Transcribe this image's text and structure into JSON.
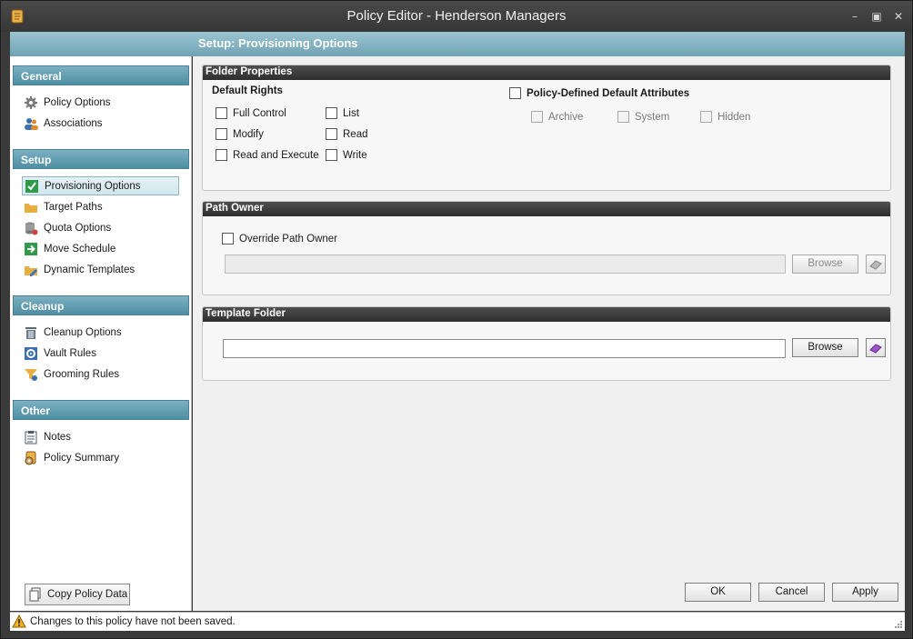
{
  "window": {
    "title": "Policy Editor - Henderson Managers",
    "controls": [
      "minimize-icon",
      "maximize-icon",
      "close-icon"
    ]
  },
  "header": {
    "title": "Setup: Provisioning Options"
  },
  "sidebar": {
    "sections": [
      {
        "title": "General",
        "items": [
          {
            "label": "Policy Options",
            "icon": "gear-icon"
          },
          {
            "label": "Associations",
            "icon": "users-icon"
          }
        ]
      },
      {
        "title": "Setup",
        "items": [
          {
            "label": "Provisioning Options",
            "icon": "checkmark-icon",
            "selected": true
          },
          {
            "label": "Target Paths",
            "icon": "folder-icon"
          },
          {
            "label": "Quota Options",
            "icon": "database-icon"
          },
          {
            "label": "Move Schedule",
            "icon": "arrow-right-icon"
          },
          {
            "label": "Dynamic Templates",
            "icon": "folder-edit-icon"
          }
        ]
      },
      {
        "title": "Cleanup",
        "items": [
          {
            "label": "Cleanup Options",
            "icon": "trash-icon"
          },
          {
            "label": "Vault Rules",
            "icon": "vault-icon"
          },
          {
            "label": "Grooming Rules",
            "icon": "funnel-icon"
          }
        ]
      },
      {
        "title": "Other",
        "items": [
          {
            "label": "Notes",
            "icon": "notes-icon"
          },
          {
            "label": "Policy Summary",
            "icon": "summary-icon"
          }
        ]
      }
    ],
    "copy_button": "Copy Policy Data"
  },
  "folder_properties": {
    "title": "Folder Properties",
    "default_rights_label": "Default Rights",
    "rights": [
      {
        "label": "Full Control",
        "checked": false
      },
      {
        "label": "List",
        "checked": false
      },
      {
        "label": "Modify",
        "checked": false
      },
      {
        "label": "Read",
        "checked": false
      },
      {
        "label": "Read and Execute",
        "checked": false
      },
      {
        "label": "Write",
        "checked": false
      }
    ],
    "policy_defined_label": "Policy-Defined Default Attributes",
    "attributes": [
      {
        "label": "Archive",
        "checked": false,
        "enabled": false
      },
      {
        "label": "System",
        "checked": false,
        "enabled": false
      },
      {
        "label": "Hidden",
        "checked": false,
        "enabled": false
      }
    ]
  },
  "path_owner": {
    "title": "Path Owner",
    "override_label": "Override Path Owner",
    "owner_value": "",
    "browse_label": "Browse",
    "clear_icon": "eraser-icon"
  },
  "template_folder": {
    "title": "Template Folder",
    "path_value": "",
    "browse_label": "Browse",
    "clear_icon": "eraser-icon"
  },
  "dialog_buttons": {
    "ok": "OK",
    "cancel": "Cancel",
    "apply": "Apply"
  },
  "status": {
    "message": "Changes to this policy have not been saved.",
    "icon": "warning-icon"
  },
  "colors": {
    "accent": "#6fa3b4",
    "section_header": "#5a97ab",
    "group_header": "#3a3a3a",
    "titlebar": "#3e3e3e"
  }
}
